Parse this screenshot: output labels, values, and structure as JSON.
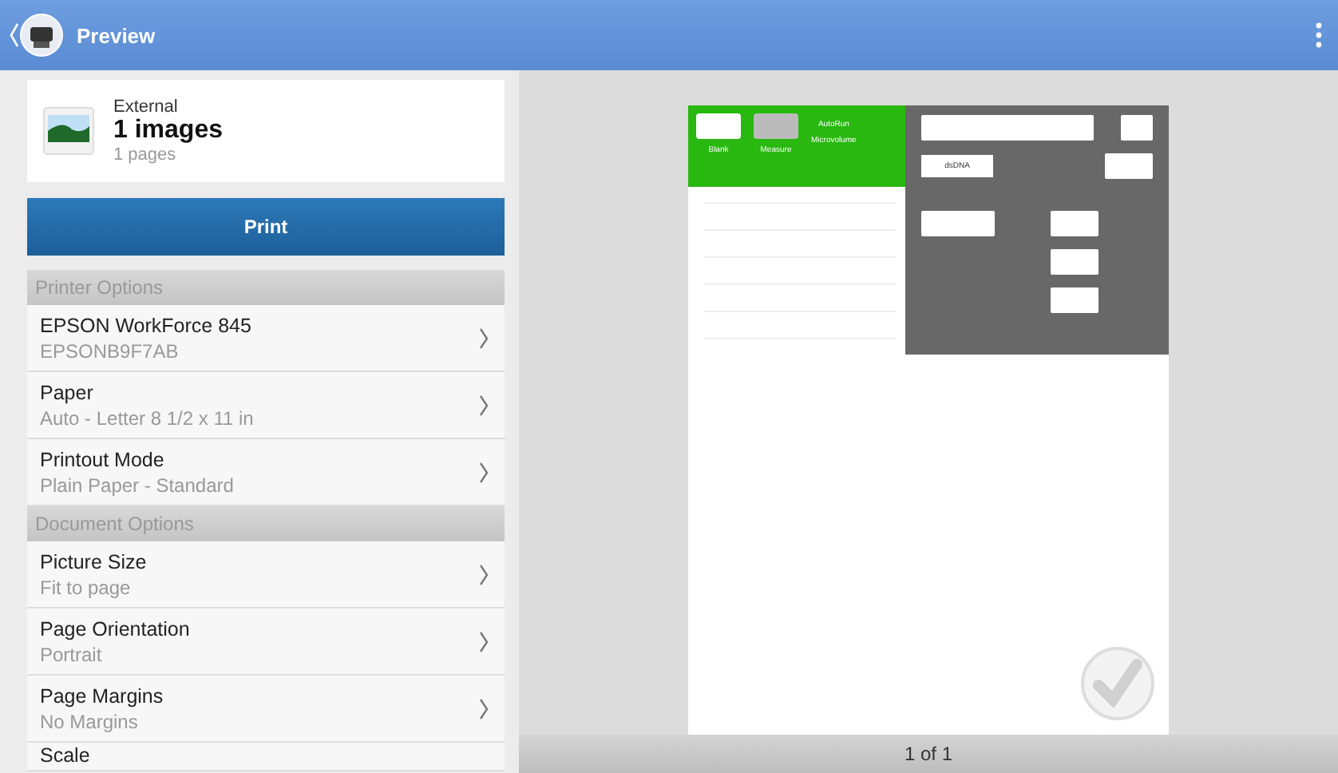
{
  "app_bar": {
    "title": "Preview"
  },
  "source": {
    "label": "External",
    "title": "1 images",
    "subtitle": "1 pages"
  },
  "print_button": {
    "label": "Print"
  },
  "sections": [
    {
      "header": "Printer Options",
      "items": [
        {
          "title": "EPSON WorkForce 845",
          "value": "EPSONB9F7AB"
        },
        {
          "title": "Paper",
          "value": "Auto - Letter 8 1/2 x 11 in"
        },
        {
          "title": "Printout Mode",
          "value": "Plain Paper - Standard"
        }
      ]
    },
    {
      "header": "Document Options",
      "items": [
        {
          "title": "Picture Size",
          "value": "Fit to page"
        },
        {
          "title": "Page Orientation",
          "value": "Portrait"
        },
        {
          "title": "Page Margins",
          "value": "No Margins"
        },
        {
          "title": "Scale"
        }
      ]
    }
  ],
  "preview": {
    "page_content": {
      "blank_label": "Blank",
      "measure_label": "Measure",
      "autorun_label": "AutoRun",
      "mode_label": "Microvolume",
      "sample_type": "dsDNA"
    },
    "page_indicator": "1 of 1"
  }
}
